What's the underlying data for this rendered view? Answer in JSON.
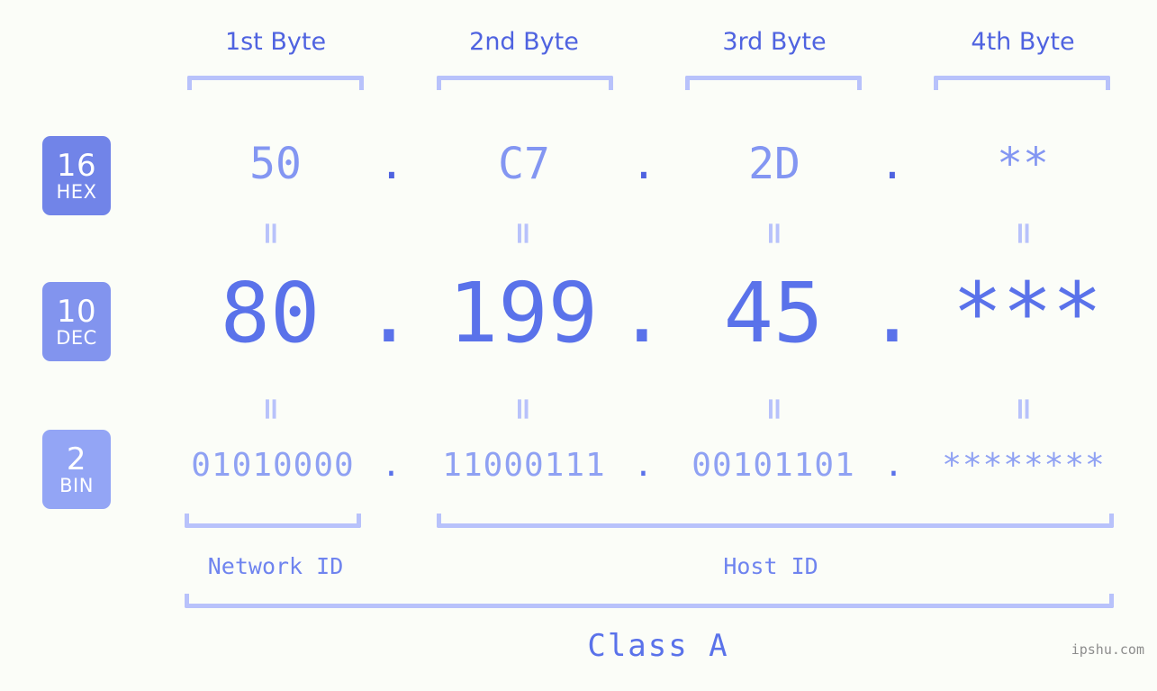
{
  "watermark": "ipshu.com",
  "headers": [
    {
      "label": "1st Byte"
    },
    {
      "label": "2nd Byte"
    },
    {
      "label": "3rd Byte"
    },
    {
      "label": "4th Byte"
    }
  ],
  "bases": [
    {
      "num": "16",
      "name": "HEX",
      "color": "#7184e8"
    },
    {
      "num": "10",
      "name": "DEC",
      "color": "#8294ee"
    },
    {
      "num": "2",
      "name": "BIN",
      "color": "#93a5f5"
    }
  ],
  "rows": {
    "hex": {
      "base": "16",
      "values": [
        "50",
        "C7",
        "2D",
        "**"
      ]
    },
    "dec": {
      "base": "10",
      "values": [
        "80",
        "199",
        "45",
        "***"
      ]
    },
    "bin": {
      "base": "2",
      "values": [
        "01010000",
        "11000111",
        "00101101",
        "********"
      ]
    }
  },
  "separators": {
    "dot": ".",
    "equals": "="
  },
  "segments": {
    "network_id": "Network ID",
    "host_id": "Host ID",
    "class": "Class A"
  },
  "colors": {
    "background": "#fbfdf8",
    "header_text": "#4f63e0",
    "bracket": "#b8c2fb",
    "hex_text": "#8396f2",
    "dec_text": "#5a72ea",
    "bin_text": "#8fa1f3",
    "equals": "#b8c2fb",
    "watermark": "#8d8d8d"
  }
}
